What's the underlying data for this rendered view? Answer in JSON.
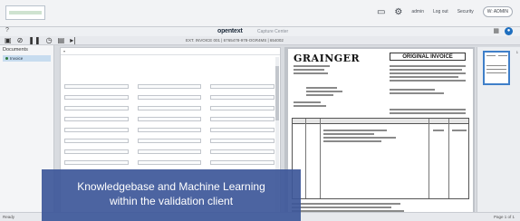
{
  "topbar": {
    "user_label": "admin",
    "logout_label": "Log out",
    "settings_label": "Security",
    "profile_label": "W: ADMIN"
  },
  "app": {
    "brand": "opentext",
    "subtitle": "Capture Center"
  },
  "toolbar": {
    "info": "EXT. INVOICE 001 | 6765478-978-OGR4MS | 654002"
  },
  "documents": {
    "header": "Documents",
    "items": [
      {
        "label": "Invoice"
      }
    ]
  },
  "invoice": {
    "logo_text": "GRAINGER",
    "title": "ORIGINAL INVOICE"
  },
  "thumbnails": {
    "page_label": "1"
  },
  "status": {
    "left": "Ready",
    "right": "Page 1 of 1"
  },
  "caption": {
    "line1": "Knowledgebase and Machine Learning",
    "line2": "within the validation client"
  },
  "colors": {
    "caption_bg": "#3d5799",
    "selection_blue": "#3f7fc9",
    "help_blue": "#1f6fbf"
  }
}
